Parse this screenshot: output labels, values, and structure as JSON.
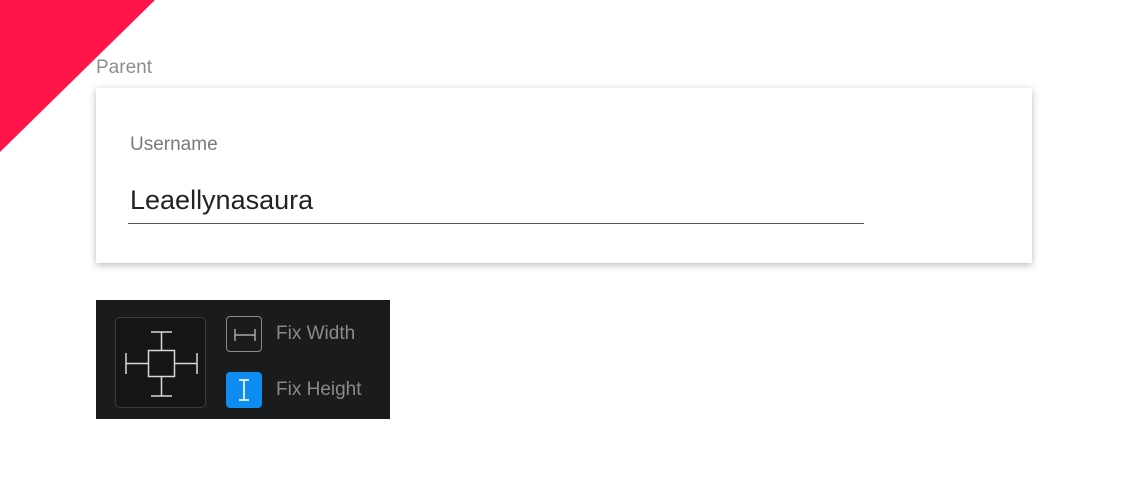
{
  "parent": {
    "label": "Parent"
  },
  "card": {
    "username_label": "Username",
    "username_value": "Leaellynasaura"
  },
  "resize_panel": {
    "fix_width_label": "Fix Width",
    "fix_width_checked": false,
    "fix_height_label": "Fix Height",
    "fix_height_checked": true,
    "icons": {
      "constraints": "pin-constraints-icon",
      "fix_width": "horizontal-span-icon",
      "fix_height": "vertical-span-icon"
    }
  },
  "colors": {
    "accent_flag": "#FF1549",
    "active_toggle": "#0E8CF0",
    "panel_bg": "#1a1b1c"
  }
}
